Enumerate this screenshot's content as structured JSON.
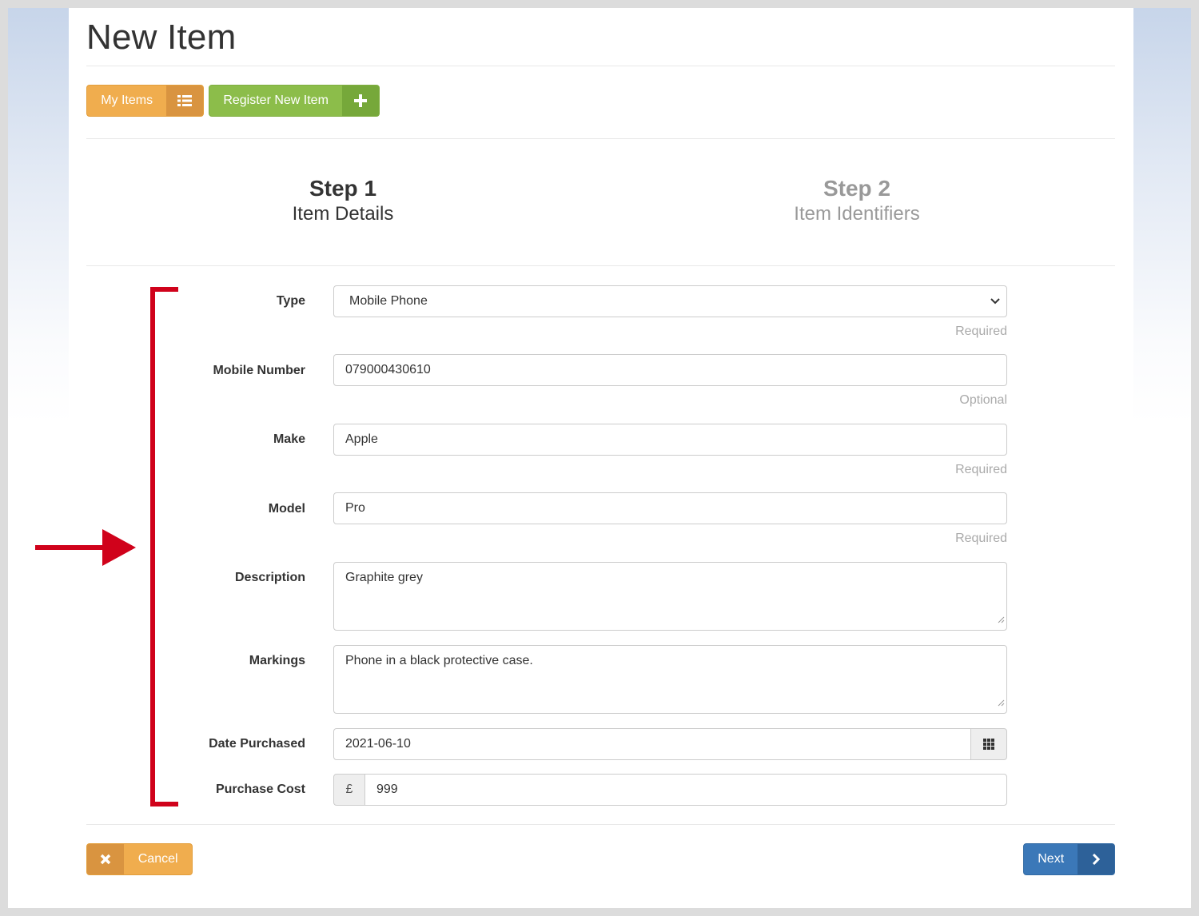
{
  "page": {
    "title": "New Item"
  },
  "toolbar": {
    "my_items_label": "My Items",
    "register_label": "Register New Item"
  },
  "steps": [
    {
      "number": "Step 1",
      "name": "Item Details",
      "active": true
    },
    {
      "number": "Step 2",
      "name": "Item Identifiers",
      "active": false
    }
  ],
  "form": {
    "type": {
      "label": "Type",
      "value": "Mobile Phone",
      "help": "Required"
    },
    "mobile_number": {
      "label": "Mobile Number",
      "value": "079000430610",
      "help": "Optional"
    },
    "make": {
      "label": "Make",
      "value": "Apple",
      "help": "Required"
    },
    "model": {
      "label": "Model",
      "value": "Pro",
      "help": "Required"
    },
    "description": {
      "label": "Description",
      "value": "Graphite grey"
    },
    "markings": {
      "label": "Markings",
      "value": "Phone in a black protective case."
    },
    "date_purchased": {
      "label": "Date Purchased",
      "value": "2021-06-10"
    },
    "purchase_cost": {
      "label": "Purchase Cost",
      "currency": "£",
      "value": "999"
    }
  },
  "footer": {
    "cancel_label": "Cancel",
    "next_label": "Next"
  },
  "icons": {
    "list": "list-icon",
    "plus": "plus-icon",
    "close": "close-icon",
    "chevron_right": "chevron-right-icon",
    "chevron_down": "chevron-down-icon",
    "calendar": "calendar-grid-icon"
  },
  "colors": {
    "warning": "#f0ad4e",
    "success": "#8cbd4a",
    "primary": "#3b78b8",
    "annotation": "#d0021b"
  }
}
